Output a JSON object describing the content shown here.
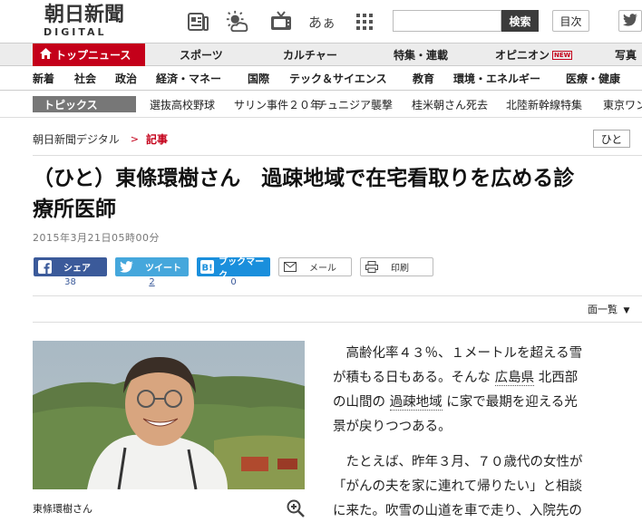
{
  "header": {
    "logo_main": "朝日新聞",
    "logo_sub": "DIGITAL",
    "icons": [
      "newspaper-icon",
      "weather-icon",
      "tv-icon",
      "hiragana-icon",
      "grid-menu-icon"
    ],
    "hiragana_glyph": "あぁ",
    "search_placeholder": "",
    "search_button": "検索",
    "toc_button": "目次"
  },
  "nav_main": {
    "top_news": "トップニュース",
    "items": [
      "スポーツ",
      "カルチャー",
      "特集・連載",
      "オピニオン",
      "写真"
    ],
    "new_badge": "NEW"
  },
  "nav_sections": [
    "新着",
    "社会",
    "政治",
    "経済・マネー",
    "国際",
    "テック＆サイエンス",
    "教育",
    "環境・エネルギー",
    "医療・健康"
  ],
  "topics": {
    "label": "トピックス",
    "items": [
      "選抜高校野球",
      "サリン事件２０年",
      "チュニジア襲撃",
      "桂米朝さん死去",
      "北陸新幹線特集",
      "東京ワン"
    ]
  },
  "breadcrumb": {
    "home": "朝日新聞デジタル",
    "separator": ">",
    "current": "記事"
  },
  "tag_button": "ひと",
  "article": {
    "headline_line1": "（ひと）東條環樹さん　過疎地域で在宅看取りを広める診",
    "headline_line2": "療所医師",
    "date": "2015年3月21日05時00分",
    "caption": "東條環樹さん",
    "body": {
      "p1_l1": "高齢化率４３％、１メートルを超える雪",
      "p1_l2": "が積もる日もある。そんな",
      "p1_link1": "広島県",
      "p1_l2b": "北西部",
      "p1_l3a": "の山間の",
      "p1_link2": "過疎地域",
      "p1_l3b": "に家で最期を迎える光",
      "p1_l4": "景が戻りつつある。",
      "p2_l1": "たとえば、昨年３月、７０歳代の女性が",
      "p2_l2": "「がんの夫を家に連れて帰りたい」と相談",
      "p2_l3": "に来た。吹雪の山道を車で走り、入院先の"
    }
  },
  "share": {
    "facebook": "シェア",
    "twitter": "ツイート",
    "bookmark": "ブックマーク",
    "mail": "メール",
    "print": "印刷",
    "facebook_count": "38",
    "twitter_count": "2",
    "bookmark_count": "0"
  },
  "page_list": "面一覧",
  "colors": {
    "brand_red": "#c4001a",
    "facebook": "#3b5a9a",
    "twitter": "#45a7dc",
    "hatena": "#1a8fdc"
  }
}
